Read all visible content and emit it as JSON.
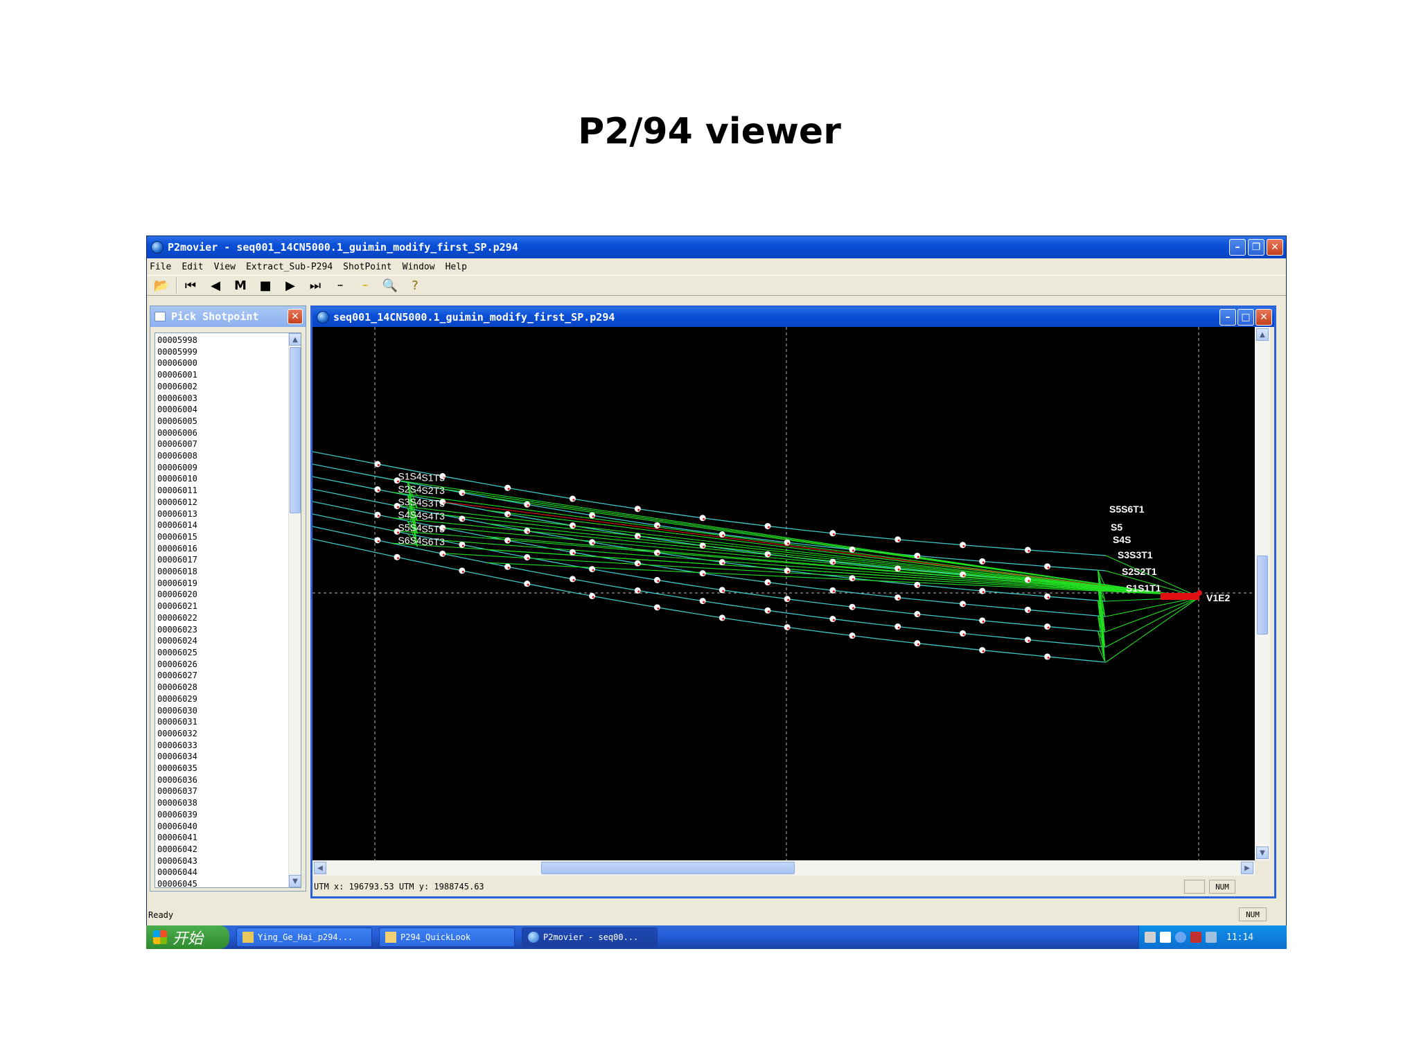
{
  "slide": {
    "title": "P2/94 viewer"
  },
  "app": {
    "title": "P2movier - seq001_14CN5000.1_guimin_modify_first_SP.p294",
    "menu": [
      "File",
      "Edit",
      "View",
      "Extract_Sub-P294",
      "ShotPoint",
      "Window",
      "Help"
    ],
    "toolbar": {
      "open_icon": "folder-open-icon",
      "first": "first-icon",
      "prev": "previous-icon",
      "marker": "M",
      "stop": "stop-icon",
      "play": "play-icon",
      "last": "last-icon",
      "ruler1": "ruler-icon",
      "ruler2": "ruler-yellow-icon",
      "zoom": "zoom-icon",
      "help": "help-icon"
    },
    "status": "Ready",
    "status_num": "NUM"
  },
  "pick_panel": {
    "title": "Pick Shotpoint",
    "items": [
      "00005998",
      "00005999",
      "00006000",
      "00006001",
      "00006002",
      "00006003",
      "00006004",
      "00006005",
      "00006006",
      "00006007",
      "00006008",
      "00006009",
      "00006010",
      "00006011",
      "00006012",
      "00006013",
      "00006014",
      "00006015",
      "00006016",
      "00006017",
      "00006018",
      "00006019",
      "00006020",
      "00006021",
      "00006022",
      "00006023",
      "00006024",
      "00006025",
      "00006026",
      "00006027",
      "00006028",
      "00006029",
      "00006030",
      "00006031",
      "00006032",
      "00006033",
      "00006034",
      "00006035",
      "00006036",
      "00006037",
      "00006038",
      "00006039",
      "00006040",
      "00006041",
      "00006042",
      "00006043",
      "00006044",
      "00006045"
    ]
  },
  "child_window": {
    "title": "seq001_14CN5000.1_guimin_modify_first_SP.p294",
    "status_text": "UTM x: 196793.53   UTM y: 1988745.63",
    "status_num": "NUM"
  },
  "plot": {
    "colors": {
      "background": "#000000",
      "streamer": "#3fc6c6",
      "tie": "#21e021",
      "highlight": "#e01010",
      "grid": "#bbbbbb",
      "node": "#ffffff",
      "label": "#ffffff"
    },
    "left_labels": [
      "S6S4",
      "S6T3",
      "S5S4",
      "S5T3",
      "S4S4",
      "S4T3",
      "S3S4",
      "S3T3",
      "S2S4",
      "S2T3",
      "S1S4",
      "S1T3"
    ],
    "right_labels": [
      "S5S6T1",
      "S5",
      "S4S",
      "S3S3T1",
      "S2S2T1",
      "S1S1T1",
      "V1E2"
    ]
  },
  "taskbar": {
    "start": "开始",
    "tasks": [
      "Ying_Ge_Hai_p294...",
      "P294_QuickLook",
      "P2movier - seq00..."
    ],
    "clock": "11:14"
  }
}
